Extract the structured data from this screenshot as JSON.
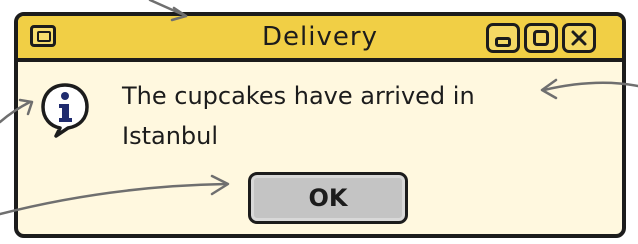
{
  "window": {
    "title": "Delivery",
    "controls": {
      "minimize_icon": "minimize-icon",
      "maximize_icon": "maximize-icon",
      "close_icon": "close-icon"
    }
  },
  "dialog": {
    "icon": "info-icon",
    "message": "The cupcakes have arrived in Istanbul",
    "ok_label": "OK"
  },
  "colors": {
    "titlebar": "#f1cf45",
    "window_background": "#fff8df",
    "button": "#c4c4c4",
    "ink": "#1c1c1c",
    "info_icon_fill": "#1f2b6e",
    "arrow": "#6f6f6f"
  }
}
